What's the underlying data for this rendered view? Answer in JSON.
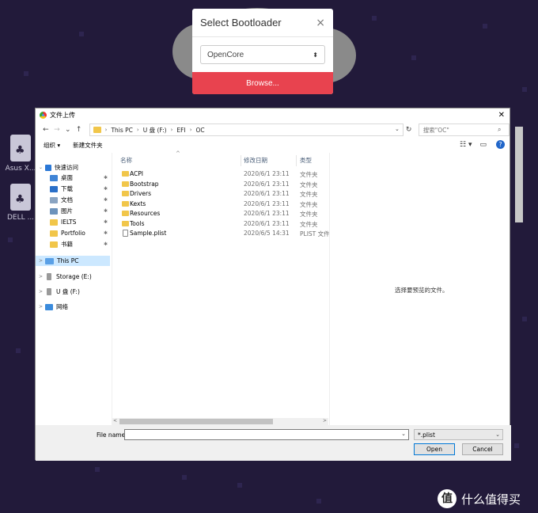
{
  "modal": {
    "title": "Select Bootloader",
    "close_glyph": "×",
    "select_value": "OpenCore",
    "select_arrow": "⬍",
    "browse_label": "Browse..."
  },
  "side_apps": [
    {
      "label": "Asus X..."
    },
    {
      "label": "DELL ..."
    }
  ],
  "dialog": {
    "title": "文件上传",
    "close_glyph": "✕",
    "nav": {
      "back": "←",
      "forward": "→",
      "down": "⌄",
      "up": "↑"
    },
    "breadcrumb": [
      "This PC",
      "U 盘 (F:)",
      "EFI",
      "OC"
    ],
    "breadcrumb_sep": "›",
    "refresh_glyph": "↻",
    "search_placeholder": "搜索\"OC\"",
    "search_glyph": "⌕",
    "toolbar": {
      "organize": "组织 ▾",
      "new_folder": "新建文件夹",
      "view_glyph": "☷ ▾",
      "pane_glyph": "▭",
      "help_glyph": "?"
    },
    "nav_pane": {
      "quick_access": "快速访问",
      "quick_items": [
        {
          "label": "桌面",
          "color": "#3f84d6"
        },
        {
          "label": "下载",
          "color": "#2a6fc8"
        },
        {
          "label": "文档",
          "color": "#8aa4c2"
        },
        {
          "label": "图片",
          "color": "#6d93bc"
        },
        {
          "label": "IELTS",
          "color": "#f1c64a"
        },
        {
          "label": "Portfolio",
          "color": "#f1c64a"
        },
        {
          "label": "书籍",
          "color": "#f1c64a"
        }
      ],
      "pin_glyph": "📌",
      "this_pc": "This PC",
      "storage": "Storage (E:)",
      "usb": "U 盘 (F:)",
      "network": "网络",
      "expand_glyph": ">"
    },
    "columns": {
      "name": "名称",
      "date": "修改日期",
      "type": "类型",
      "sort_glyph": "^"
    },
    "files": [
      {
        "name": "ACPI",
        "date": "2020/6/1 23:11",
        "type": "文件夹",
        "kind": "folder"
      },
      {
        "name": "Bootstrap",
        "date": "2020/6/1 23:11",
        "type": "文件夹",
        "kind": "folder"
      },
      {
        "name": "Drivers",
        "date": "2020/6/1 23:11",
        "type": "文件夹",
        "kind": "folder"
      },
      {
        "name": "Kexts",
        "date": "2020/6/1 23:11",
        "type": "文件夹",
        "kind": "folder"
      },
      {
        "name": "Resources",
        "date": "2020/6/1 23:11",
        "type": "文件夹",
        "kind": "folder"
      },
      {
        "name": "Tools",
        "date": "2020/6/1 23:11",
        "type": "文件夹",
        "kind": "folder"
      },
      {
        "name": "Sample.plist",
        "date": "2020/6/5 14:31",
        "type": "PLIST 文件",
        "kind": "file"
      }
    ],
    "scroll": {
      "left": "<",
      "right": ">"
    },
    "preview_text": "选择要预览的文件。",
    "footer": {
      "file_name_label": "File name:",
      "file_name_value": "",
      "filter_value": "*.plist",
      "dd_glyph": "⌄",
      "open_label": "Open",
      "cancel_label": "Cancel"
    }
  },
  "watermark": {
    "badge": "值",
    "text": "什么值得买"
  },
  "colors": {
    "background": "#221a3a",
    "accent": "#e8434f",
    "selection": "#cce8ff"
  }
}
